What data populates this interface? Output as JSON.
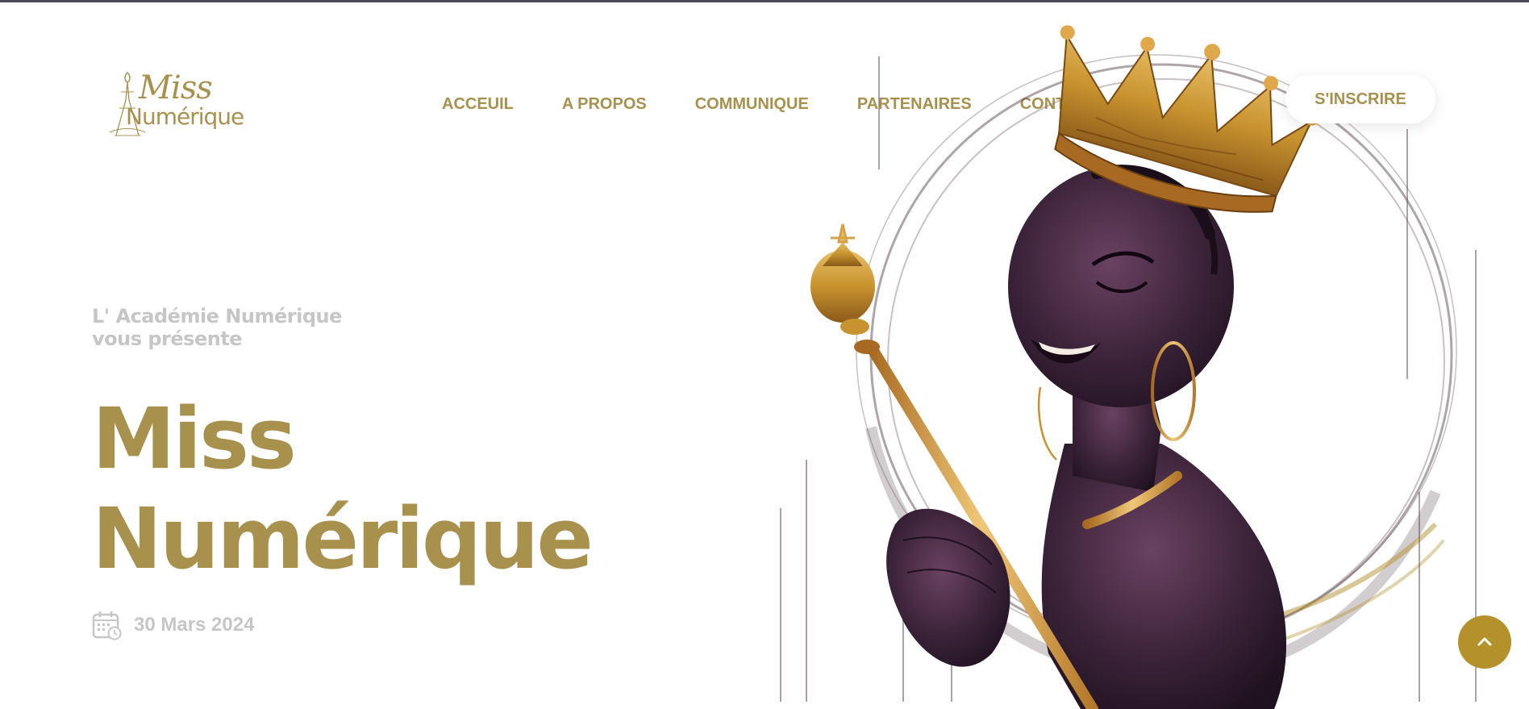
{
  "logo": {
    "line1": "Miss",
    "line2": "Numérique"
  },
  "nav": {
    "items": [
      {
        "label": "ACCEUIL"
      },
      {
        "label": "A PROPOS"
      },
      {
        "label": "COMMUNIQUE"
      },
      {
        "label": "PARTENAIRES"
      },
      {
        "label": "CONTACT"
      }
    ],
    "cta_label": "S'INSCRIRE"
  },
  "hero": {
    "subtitle_line1": "L' Académie Numérique",
    "subtitle_line2": "vous présente",
    "title_line1": "Miss",
    "title_line2": "Numérique",
    "date": "30 Mars 2024"
  },
  "colors": {
    "accent": "#a8904d",
    "muted_text": "#c6c6c6",
    "scroll_button": "#b4912b",
    "skin": "#3a2238",
    "gold": "#c8922e"
  },
  "icons": {
    "calendar": "calendar-icon",
    "scroll_top": "chevron-up-icon"
  }
}
